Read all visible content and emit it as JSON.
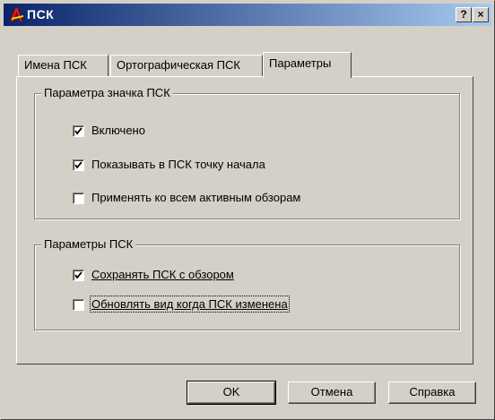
{
  "window": {
    "title": "ПСК",
    "help_button": "?",
    "close_button": "×"
  },
  "tabs": [
    {
      "label": "Имена ПСК",
      "active": false
    },
    {
      "label": "Ортографическая ПСК",
      "active": false
    },
    {
      "label": "Параметры",
      "active": true
    }
  ],
  "icon_group": {
    "label": "Параметра значка ПСК",
    "options": [
      {
        "label": "Включено",
        "checked": true
      },
      {
        "label": "Показывать в ПСК точку начала",
        "checked": true
      },
      {
        "label": "Применять ко всем активным обзорам",
        "checked": false
      }
    ]
  },
  "ucs_group": {
    "label": "Параметры ПСК",
    "options": [
      {
        "label": "Сохранять ПСК с обзором",
        "checked": true
      },
      {
        "label": "Обновлять вид когда ПСК изменена",
        "checked": false
      }
    ]
  },
  "buttons": {
    "ok": "OK",
    "cancel": "Отмена",
    "help": "Справка"
  }
}
